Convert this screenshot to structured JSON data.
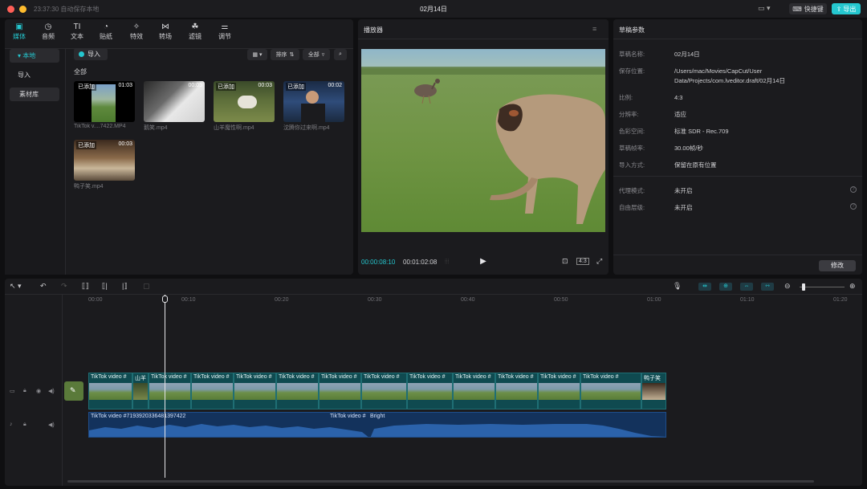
{
  "titlebar": {
    "saved_status": "23:37:30 自动保存本地",
    "title": "02月14日",
    "shortcut_label": "快捷键",
    "export_label": "导出"
  },
  "media": {
    "tabs": [
      "媒体",
      "音频",
      "文本",
      "贴纸",
      "特效",
      "转场",
      "滤镜",
      "调节"
    ],
    "sidebar": [
      "本地",
      "导入",
      "素材库"
    ],
    "import_label": "导入",
    "sort_label": "排序",
    "filter_label": "全部",
    "section_label": "全部",
    "added_label": "已添加",
    "clips": [
      {
        "name": "TikTok v....7422.MP4",
        "duration": "01:03",
        "added": true
      },
      {
        "name": "鹅笑.mp4",
        "duration": "00:05",
        "added": false
      },
      {
        "name": "山羊魔性啊.mp4",
        "duration": "00:03",
        "added": true
      },
      {
        "name": "沈腾你过来啊.mp4",
        "duration": "00:02",
        "added": true
      },
      {
        "name": "鸭子笑.mp4",
        "duration": "00:03",
        "added": true
      }
    ]
  },
  "player": {
    "title": "播放器",
    "time_current": "00:00:08:10",
    "time_total": "00:01:02:08",
    "ratio_label": "4:3"
  },
  "props": {
    "title": "草稿参数",
    "rows": [
      {
        "key": "草稿名称:",
        "value": "02月14日"
      },
      {
        "key": "保存位置:",
        "value": "/Users/mac/Movies/CapCut/User Data/Projects/com.lveditor.draft/02月14日"
      },
      {
        "key": "比例:",
        "value": "4:3"
      },
      {
        "key": "分辨率:",
        "value": "适应"
      },
      {
        "key": "色彩空间:",
        "value": "标准 SDR - Rec.709"
      },
      {
        "key": "草稿帧率:",
        "value": "30.00帧/秒"
      },
      {
        "key": "导入方式:",
        "value": "保留在原有位置"
      }
    ],
    "extra_rows": [
      {
        "key": "代理模式:",
        "value": "未开启"
      },
      {
        "key": "自由层级:",
        "value": "未开启"
      }
    ],
    "modify_label": "修改"
  },
  "timeline": {
    "ticks": [
      "00:00",
      "00:10",
      "00:20",
      "00:30",
      "00:40",
      "00:50",
      "01:00",
      "01:10",
      "01:20"
    ],
    "video_clips": [
      {
        "label": "TikTok video #"
      },
      {
        "label": "山羊"
      },
      {
        "label": "TikTok video #"
      },
      {
        "label": "TikTok video #"
      },
      {
        "label": "TikTok video #"
      },
      {
        "label": "TikTok video #"
      },
      {
        "label": "TikTok video #"
      },
      {
        "label": "TikTok video #"
      },
      {
        "label": "TikTok video #"
      },
      {
        "label": "TikTok video #"
      },
      {
        "label": "TikTok video #"
      },
      {
        "label": "TikTok video #"
      },
      {
        "label": "TikTok video #"
      },
      {
        "label": "鸭子笑"
      }
    ],
    "audio_label_1": "TikTok video #7193920336481397422",
    "audio_label_2": "TikTok video #",
    "audio_label_3": "Bright"
  },
  "colors": {
    "accent": "#25c7cf",
    "panel": "#1b1b1e",
    "background": "#0f0f11"
  }
}
